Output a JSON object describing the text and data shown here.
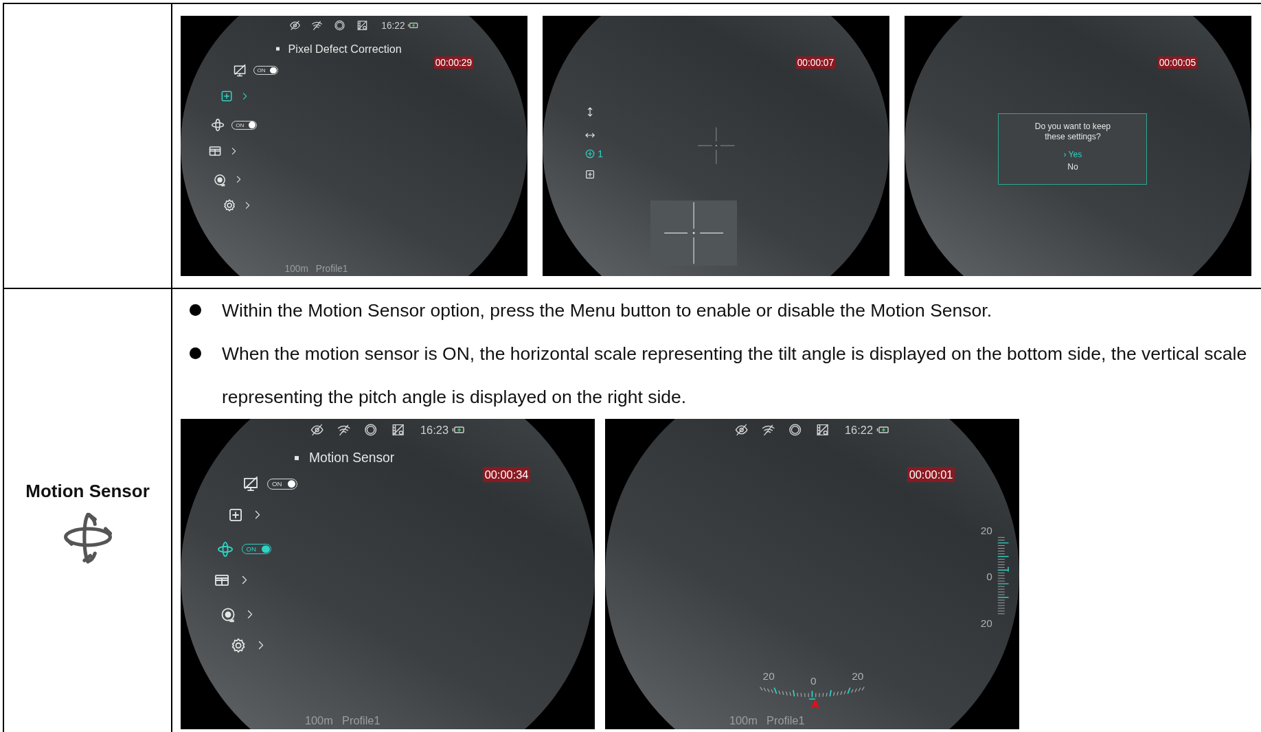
{
  "table": {
    "rows": [
      {
        "kind": "continuation",
        "screens": [
          {
            "kind": "menu",
            "status_bar": {
              "time": "16:22"
            },
            "title": "Pixel Defect Correction",
            "timer": "00:00:29",
            "items": [
              {
                "kind": "toggle",
                "label": "ON",
                "on": true,
                "selected": false
              },
              {
                "kind": "submenu",
                "selected": true
              },
              {
                "kind": "toggle",
                "label": "ON",
                "on": true,
                "selected": false
              },
              {
                "kind": "submenu",
                "selected": false
              },
              {
                "kind": "submenu",
                "selected": false
              },
              {
                "kind": "submenu",
                "selected": false
              }
            ],
            "footer": {
              "distance": "100m",
              "profile": "Profile1"
            }
          },
          {
            "kind": "zeroing",
            "timer": "00:00:07",
            "controls": [
              {
                "kind": "vertical",
                "selected": false
              },
              {
                "kind": "horizontal",
                "selected": false
              },
              {
                "kind": "step",
                "label": "1",
                "selected": true
              },
              {
                "kind": "add",
                "selected": false
              }
            ]
          },
          {
            "kind": "confirm",
            "timer": "00:00:05",
            "message": "Do you want to keep these settings?",
            "cursor": "›",
            "options": [
              {
                "label": "Yes",
                "selected": true
              },
              {
                "label": "No",
                "selected": false
              }
            ]
          }
        ]
      },
      {
        "kind": "feature",
        "label": "Motion Sensor",
        "bullets": [
          "Within the Motion Sensor option, press the Menu button to enable or disable the Motion Sensor.",
          "When the motion sensor is ON, the horizontal scale representing the tilt angle is displayed on the bottom side, the vertical scale representing the pitch angle is displayed on the right side."
        ],
        "screens": [
          {
            "kind": "menu",
            "status_bar": {
              "time": "16:23"
            },
            "title": "Motion Sensor",
            "timer": "00:00:34",
            "items": [
              {
                "kind": "toggle",
                "label": "ON",
                "on": true,
                "selected": false
              },
              {
                "kind": "submenu",
                "selected": false
              },
              {
                "kind": "toggle",
                "label": "ON",
                "on": true,
                "selected": true
              },
              {
                "kind": "submenu",
                "selected": false
              },
              {
                "kind": "submenu",
                "selected": false
              },
              {
                "kind": "submenu",
                "selected": false
              }
            ],
            "footer": {
              "distance": "100m",
              "profile": "Profile1"
            }
          },
          {
            "kind": "level",
            "status_bar": {
              "time": "16:22"
            },
            "timer": "00:00:01",
            "pitch_scale": {
              "labels": [
                "20",
                "0",
                "20"
              ]
            },
            "tilt_scale": {
              "labels": [
                "20",
                "0",
                "20"
              ]
            },
            "footer": {
              "distance": "100m",
              "profile": "Profile1"
            }
          }
        ]
      }
    ]
  }
}
